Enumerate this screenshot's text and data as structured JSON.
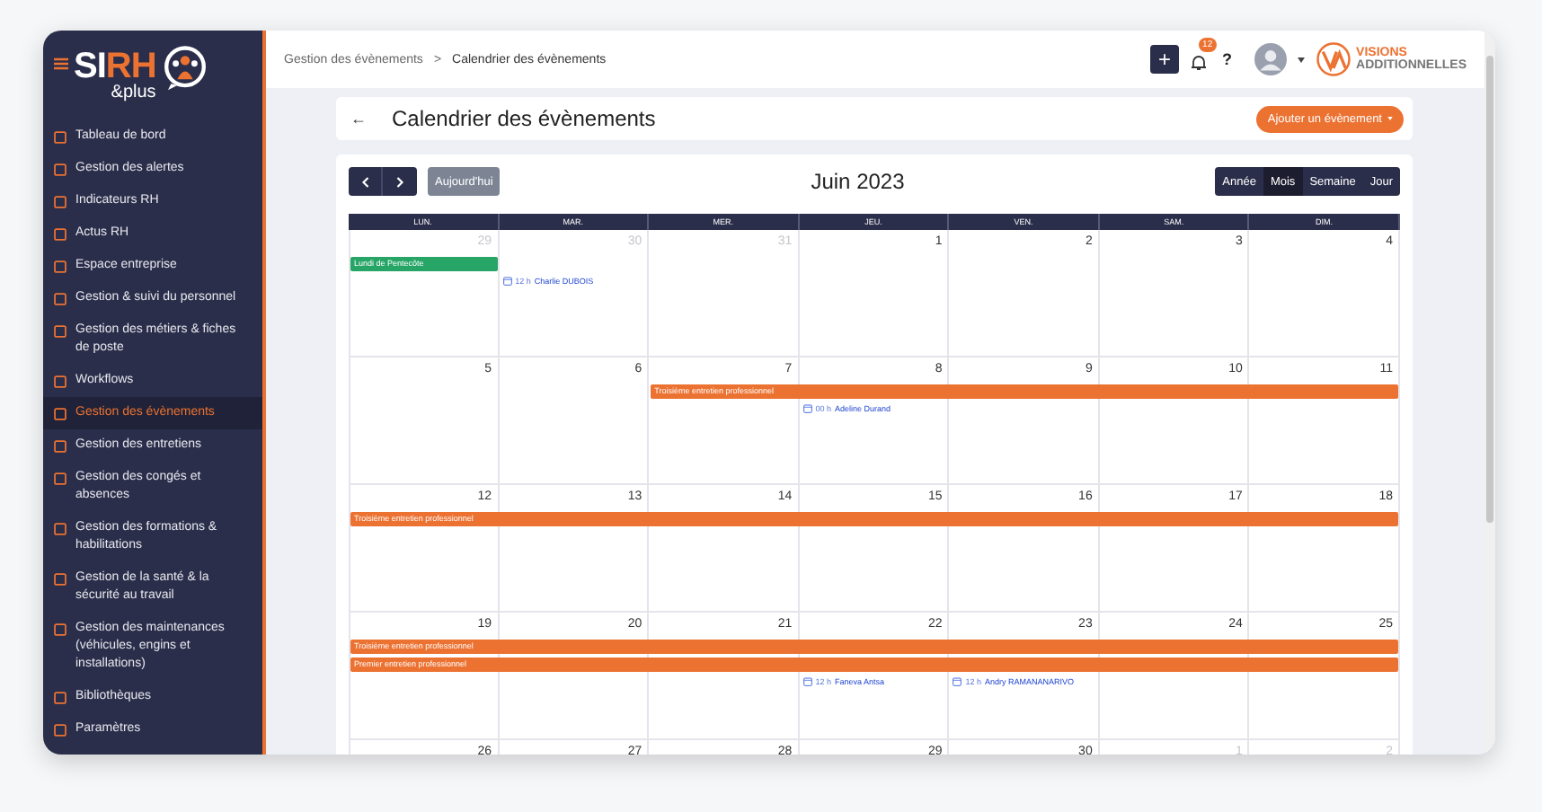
{
  "logo": {
    "part_1": "SI",
    "part_2": "RH",
    "sub": "&plus"
  },
  "sidebar": {
    "items": [
      {
        "label": "Tableau de bord",
        "selected": false
      },
      {
        "label": "Gestion des alertes",
        "selected": false
      },
      {
        "label": "Indicateurs RH",
        "selected": false
      },
      {
        "label": "Actus RH",
        "selected": false
      },
      {
        "label": "Espace entreprise",
        "selected": false
      },
      {
        "label": "Gestion & suivi du personnel",
        "selected": false
      },
      {
        "label": "Gestion des métiers & fiches de poste",
        "selected": false
      },
      {
        "label": "Workflows",
        "selected": false
      },
      {
        "label": "Gestion des évènements",
        "selected": true
      },
      {
        "label": "Gestion des entretiens",
        "selected": false
      },
      {
        "label": "Gestion des congés et absences",
        "selected": false
      },
      {
        "label": "Gestion des formations & habilitations",
        "selected": false
      },
      {
        "label": "Gestion de la santé & la sécurité au travail",
        "selected": false
      },
      {
        "label": "Gestion des maintenances (véhicules, engins et installations)",
        "selected": false
      },
      {
        "label": "Bibliothèques",
        "selected": false
      },
      {
        "label": "Paramètres",
        "selected": false
      }
    ]
  },
  "topbar": {
    "breadcrumb": [
      "Gestion des évènements",
      "Calendrier des évènements"
    ],
    "separator": ">",
    "plus": "+",
    "notifications": "12",
    "help": "?",
    "brand": [
      "VISIONS",
      "ADDITIONNELLES"
    ]
  },
  "page": {
    "back": "←",
    "title": "Calendrier des évènements",
    "add_button": "Ajouter un évènement"
  },
  "calendar": {
    "today_button": "Aujourd'hui",
    "title": "Juin 2023",
    "views": [
      {
        "label": "Année",
        "selected": false
      },
      {
        "label": "Mois",
        "selected": true
      },
      {
        "label": "Semaine",
        "selected": false
      },
      {
        "label": "Jour",
        "selected": false
      }
    ],
    "weekdays": [
      "LUN.",
      "MAR.",
      "MER.",
      "JEU.",
      "VEN.",
      "SAM.",
      "DIM."
    ],
    "weeks": [
      {
        "days": [
          {
            "number": "29",
            "muted": true,
            "bars": [
              {
                "kind": "start",
                "label": "Lundi de Pentecôte",
                "color": "#27a567"
              }
            ]
          },
          {
            "number": "30",
            "muted": true,
            "items": [
              {
                "time": "12 h",
                "name": "Charlie DUBOIS"
              }
            ]
          },
          {
            "number": "31",
            "muted": true
          },
          {
            "number": "1",
            "muted": false
          },
          {
            "number": "2",
            "muted": false
          },
          {
            "number": "3",
            "muted": false
          },
          {
            "number": "4",
            "muted": false
          }
        ]
      },
      {
        "days": [
          {
            "number": "5",
            "muted": false
          },
          {
            "number": "6",
            "muted": false
          },
          {
            "number": "7",
            "muted": false,
            "bars": [
              {
                "kind": "start",
                "label": "Troisième entretien professionnel",
                "color": "#ec7232"
              }
            ]
          },
          {
            "number": "8",
            "muted": false,
            "bars": [
              {
                "kind": "through"
              }
            ],
            "items": [
              {
                "time": "00 h",
                "name": "Adeline Durand"
              }
            ]
          },
          {
            "number": "9",
            "muted": false,
            "bars": [
              {
                "kind": "through"
              }
            ]
          },
          {
            "number": "10",
            "muted": false,
            "bars": [
              {
                "kind": "through"
              }
            ]
          },
          {
            "number": "11",
            "muted": false,
            "bars": [
              {
                "kind": "through"
              }
            ]
          }
        ]
      },
      {
        "days": [
          {
            "number": "12",
            "muted": false,
            "bars": [
              {
                "kind": "start",
                "label": "Troisième entretien professionnel",
                "color": "#ec7232"
              }
            ]
          },
          {
            "number": "13",
            "muted": false,
            "bars": [
              {
                "kind": "through"
              }
            ]
          },
          {
            "number": "14",
            "muted": false,
            "bars": [
              {
                "kind": "through"
              }
            ]
          },
          {
            "number": "15",
            "muted": false,
            "bars": [
              {
                "kind": "through"
              }
            ]
          },
          {
            "number": "16",
            "muted": false,
            "bars": [
              {
                "kind": "through"
              }
            ]
          },
          {
            "number": "17",
            "muted": false,
            "bars": [
              {
                "kind": "through"
              }
            ]
          },
          {
            "number": "18",
            "muted": false,
            "bars": [
              {
                "kind": "through"
              }
            ]
          }
        ]
      },
      {
        "days": [
          {
            "number": "19",
            "muted": false,
            "bars": [
              {
                "kind": "start",
                "label": "Troisième entretien professionnel",
                "color": "#ec7232"
              },
              {
                "kind": "start",
                "label": "Premier entretien professionnel",
                "color": "#ec7232"
              }
            ]
          },
          {
            "number": "20",
            "muted": false,
            "bars": [
              {
                "kind": "through"
              },
              {
                "kind": "through"
              }
            ]
          },
          {
            "number": "21",
            "muted": false,
            "bars": [
              {
                "kind": "through"
              },
              {
                "kind": "through"
              }
            ]
          },
          {
            "number": "22",
            "muted": false,
            "bars": [
              {
                "kind": "through"
              },
              {
                "kind": "through"
              }
            ],
            "items": [
              {
                "time": "12 h",
                "name": "Faneva Antsa"
              }
            ]
          },
          {
            "number": "23",
            "muted": false,
            "bars": [
              {
                "kind": "through"
              },
              {
                "kind": "through"
              }
            ],
            "items": [
              {
                "time": "12 h",
                "name": "Andry RAMANANARIVO"
              }
            ]
          },
          {
            "number": "24",
            "muted": false,
            "bars": [
              {
                "kind": "through"
              },
              {
                "kind": "through"
              }
            ]
          },
          {
            "number": "25",
            "muted": false,
            "bars": [
              {
                "kind": "through"
              },
              {
                "kind": "through"
              }
            ]
          }
        ]
      },
      {
        "days": [
          {
            "number": "26",
            "muted": false
          },
          {
            "number": "27",
            "muted": false
          },
          {
            "number": "28",
            "muted": false
          },
          {
            "number": "29",
            "muted": false
          },
          {
            "number": "30",
            "muted": false
          },
          {
            "number": "1",
            "muted": true
          },
          {
            "number": "2",
            "muted": true
          }
        ]
      }
    ]
  }
}
